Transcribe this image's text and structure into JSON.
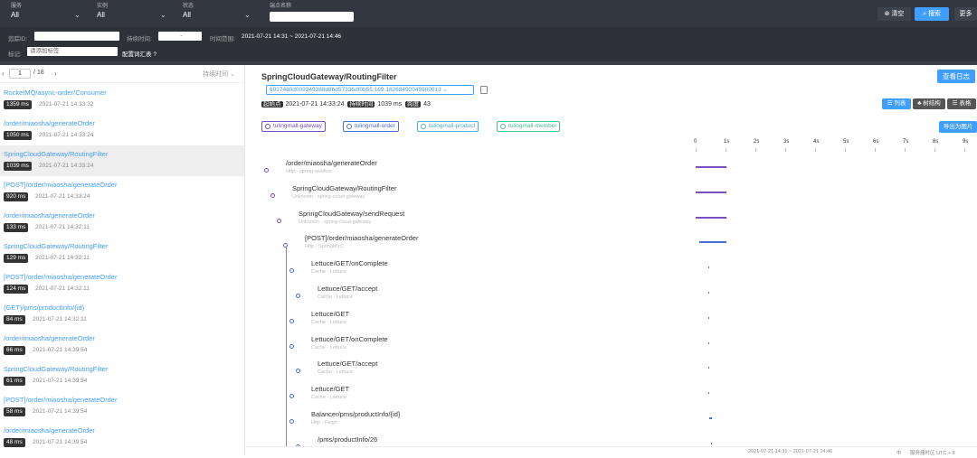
{
  "filters": [
    {
      "label": "服务",
      "value": "All"
    },
    {
      "label": "实例",
      "value": "All"
    },
    {
      "label": "状态",
      "value": "All"
    },
    {
      "label": "端点名称",
      "value": ""
    }
  ],
  "buttons": {
    "clear": "清空",
    "search": "搜索",
    "more": "更多"
  },
  "bar2": {
    "trace_id_label": "追踪ID:",
    "duration_label": "持续时间:",
    "duration_sep": "-",
    "time_range_label": "时间范围:",
    "time_range_value": "2021-07-21 14:31 ~ 2021-07-21 14:46",
    "tags_label": "标记:",
    "tags_placeholder": "请添加标签",
    "tags_link": "配置词汇表"
  },
  "pager": {
    "prev": "‹",
    "page": "1",
    "total": "/ 18",
    "next": "›",
    "sort": "持续时间"
  },
  "traces": [
    {
      "name": "RocketMQ/async-order/Consumer",
      "duration": "1359 ms",
      "time": "2021-07-21 14:33:32"
    },
    {
      "name": "/order/miaosha/generateOrder",
      "duration": "1050 ms",
      "time": "2021-07-21 14:33:24"
    },
    {
      "name": "SpringCloudGateway/RoutingFilter",
      "duration": "1039 ms",
      "time": "2021-07-21 14:33:24"
    },
    {
      "name": "[POST]/order/miaosha/generateOrder",
      "duration": "920 ms",
      "time": "2021-07-21 14:33:24"
    },
    {
      "name": "/order/miaosha/generateOrder",
      "duration": "133 ms",
      "time": "2021-07-21 14:32:11"
    },
    {
      "name": "SpringCloudGateway/RoutingFilter",
      "duration": "129 ms",
      "time": "2021-07-21 14:32:11"
    },
    {
      "name": "[POST]/order/miaosha/generateOrder",
      "duration": "124 ms",
      "time": "2021-07-21 14:32:11"
    },
    {
      "name": "{GET}/pms/productInfo/{id}",
      "duration": "84 ms",
      "time": "2021-07-21 14:32:11"
    },
    {
      "name": "/order/miaosha/generateOrder",
      "duration": "66 ms",
      "time": "2021-07-21 14:39:54"
    },
    {
      "name": "SpringCloudGateway/RoutingFilter",
      "duration": "61 ms",
      "time": "2021-07-21 14:39:54"
    },
    {
      "name": "[POST]/order/miaosha/generateOrder",
      "duration": "58 ms",
      "time": "2021-07-21 14:39:54"
    },
    {
      "name": "/order/miaosha/generateOrder",
      "duration": "48 ms",
      "time": "2021-07-21 14:39:54"
    }
  ],
  "detail": {
    "title": "SpringCloudGateway/RoutingFilter",
    "trace_id": "6917480d009249388d8bd57336df0b55.169.16268492045900013",
    "start_label": "起始点",
    "start_value": "2021-07-21 14:33:24",
    "duration_label": "持续时间",
    "duration_value": "1039 ms",
    "span_label": "跨度",
    "span_value": "43",
    "view_log": "查看日志",
    "views": [
      "列表",
      "树结构",
      "表格"
    ],
    "export": "导出为图片",
    "services": [
      "tulingmall-gateway",
      "tulingmall-order",
      "tulingmall-product",
      "tulingmall-member"
    ],
    "service_colors": [
      "#7b4fbf",
      "#4b6fd8",
      "#4aaed0",
      "#43c48a"
    ],
    "axis": [
      "0",
      "1s",
      "2s",
      "3s",
      "4s",
      "5s",
      "6s",
      "7s",
      "8s",
      "9s"
    ]
  },
  "spans": [
    {
      "name": "/order/miaosha/generateOrder",
      "sub": "Http - spring-webflux",
      "depth": 0,
      "service": 0,
      "start_s": 0.0,
      "dur_s": 1.039
    },
    {
      "name": "SpringCloudGateway/RoutingFilter",
      "sub": "Unknown - spring-cloud-gateway",
      "depth": 1,
      "service": 0,
      "start_s": 0.0,
      "dur_s": 1.039
    },
    {
      "name": "SpringCloudGateway/sendRequest",
      "sub": "Unknown - spring-cloud-gateway",
      "depth": 2,
      "service": 0,
      "start_s": 0.0,
      "dur_s": 1.039
    },
    {
      "name": "[POST]/order/miaosha/generateOrder",
      "sub": "Http - SpringMVC",
      "depth": 3,
      "service": 1,
      "start_s": 0.12,
      "dur_s": 0.92
    },
    {
      "name": "Lettuce/GET/onComplete",
      "sub": "Cache - Lettuce",
      "depth": 4,
      "service": 1,
      "start_s": 0.42,
      "dur_s": 0.01
    },
    {
      "name": "Lettuce/GET/accept",
      "sub": "Cache - Lettuce",
      "depth": 5,
      "service": 1,
      "start_s": 0.42,
      "dur_s": 0.01
    },
    {
      "name": "Lettuce/GET",
      "sub": "Cache - Lettuce",
      "depth": 4,
      "service": 1,
      "start_s": 0.42,
      "dur_s": 0.01
    },
    {
      "name": "Lettuce/GET/onComplete",
      "sub": "Cache - Lettuce",
      "depth": 4,
      "service": 1,
      "start_s": 0.42,
      "dur_s": 0.01
    },
    {
      "name": "Lettuce/GET/accept",
      "sub": "Cache - Lettuce",
      "depth": 5,
      "service": 1,
      "start_s": 0.42,
      "dur_s": 0.01
    },
    {
      "name": "Lettuce/GET",
      "sub": "Cache - Lettuce",
      "depth": 4,
      "service": 1,
      "start_s": 0.42,
      "dur_s": 0.01
    },
    {
      "name": "Balancer/pms/productInfo/{id}",
      "sub": "Http - Feign",
      "depth": 4,
      "service": 1,
      "start_s": 0.44,
      "dur_s": 0.12
    },
    {
      "name": "/pms/productInfo/26",
      "sub": "",
      "depth": 5,
      "service": 1,
      "start_s": 0.5,
      "dur_s": 0.01
    }
  ],
  "footer": {
    "range": "2021-07-21 14:31 ~ 2021-07-21 14:46",
    "lang": "中",
    "tz": "服务器时区 UTC + 8"
  }
}
